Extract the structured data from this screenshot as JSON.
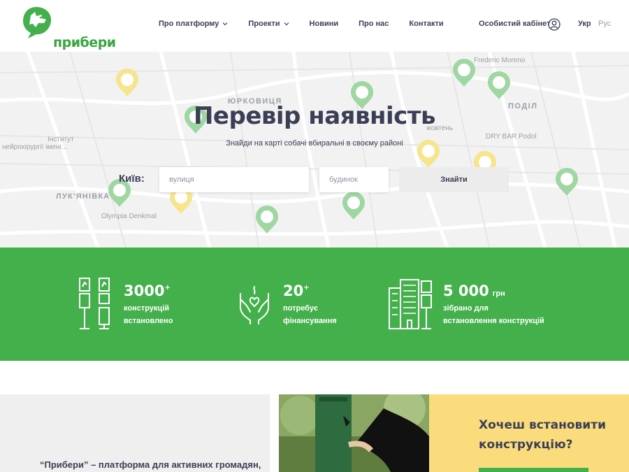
{
  "brand": {
    "name": "прибери",
    "accent": "#44b04c",
    "dark": "#3a3f55"
  },
  "nav": {
    "items": [
      {
        "label": "Про платформу",
        "has_dropdown": true
      },
      {
        "label": "Проекти",
        "has_dropdown": true
      },
      {
        "label": "Новини",
        "has_dropdown": false
      },
      {
        "label": "Про нас",
        "has_dropdown": false
      },
      {
        "label": "Контакти",
        "has_dropdown": false
      }
    ],
    "cabinet_label": "Особистий кабінет",
    "lang_active": "Укр",
    "lang_other": "Рус"
  },
  "hero": {
    "title": "Перевір наявність",
    "subtitle": "Знайди на карті собачі вбиральні в своєму районі",
    "city_label": "Київ:",
    "street_placeholder": "вулиця",
    "house_placeholder": "будинок",
    "find_label": "Знайти",
    "map_labels": {
      "yurkovytsia": "ЮРКОВИЦЯ",
      "podil": "ПОДІЛ",
      "luk_yanivka": "ЛУК'ЯНІВКА",
      "institute": "Інститут",
      "neuro": "нейрохірургії імені...",
      "zhovten": "жовтень",
      "frederic": "Frederic Moreno",
      "dry_bar": "DRY BAR Podol",
      "olympia": "Olympia Denkmal"
    }
  },
  "stats": [
    {
      "number": "3000",
      "sup": "+",
      "unit": "",
      "line1": "конструкцій",
      "line2": "встановлено",
      "icon": "dispensers-icon"
    },
    {
      "number": "20",
      "sup": "+",
      "unit": "",
      "line1": "потребує",
      "line2": "фінансування",
      "icon": "hands-icon"
    },
    {
      "number": "5 000",
      "sup": "",
      "unit": "грн",
      "line1": "зібрано для",
      "line2": "встановлення конструкцій",
      "icon": "buildings-icon"
    }
  ],
  "about": {
    "text": "“Прибери” – платформа для активних громадян,"
  },
  "cta": {
    "title": "Хочеш встановити конструкцію?"
  }
}
